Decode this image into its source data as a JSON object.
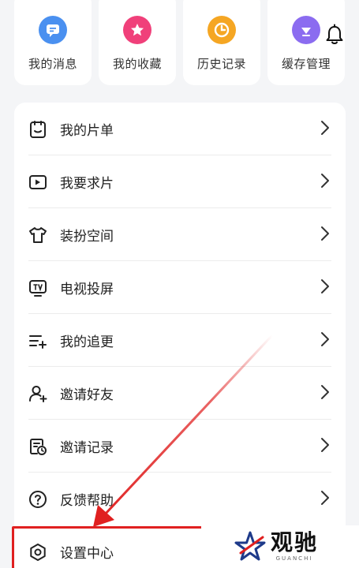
{
  "quick_tiles": [
    {
      "label": "我的消息",
      "icon": "message-icon",
      "color": "#4a90f0"
    },
    {
      "label": "我的收藏",
      "icon": "star-icon",
      "color": "#f0407a"
    },
    {
      "label": "历史记录",
      "icon": "clock-icon",
      "color": "#f5a623"
    },
    {
      "label": "缓存管理",
      "icon": "download-icon",
      "color": "#8b6cf0"
    }
  ],
  "header": {
    "notification_icon": "bell-icon"
  },
  "menu": [
    {
      "label": "我的片单",
      "icon": "playlist-icon"
    },
    {
      "label": "我要求片",
      "icon": "request-video-icon"
    },
    {
      "label": "装扮空间",
      "icon": "tshirt-icon"
    },
    {
      "label": "电视投屏",
      "icon": "tv-cast-icon"
    },
    {
      "label": "我的追更",
      "icon": "follow-list-icon"
    },
    {
      "label": "邀请好友",
      "icon": "add-user-icon"
    },
    {
      "label": "邀请记录",
      "icon": "invite-record-icon"
    },
    {
      "label": "反馈帮助",
      "icon": "help-icon"
    },
    {
      "label": "设置中心",
      "icon": "gear-icon"
    }
  ],
  "annotation": {
    "highlight_color": "#e02020"
  },
  "watermark": {
    "text": "观驰",
    "subtext": "GUANCHI"
  }
}
